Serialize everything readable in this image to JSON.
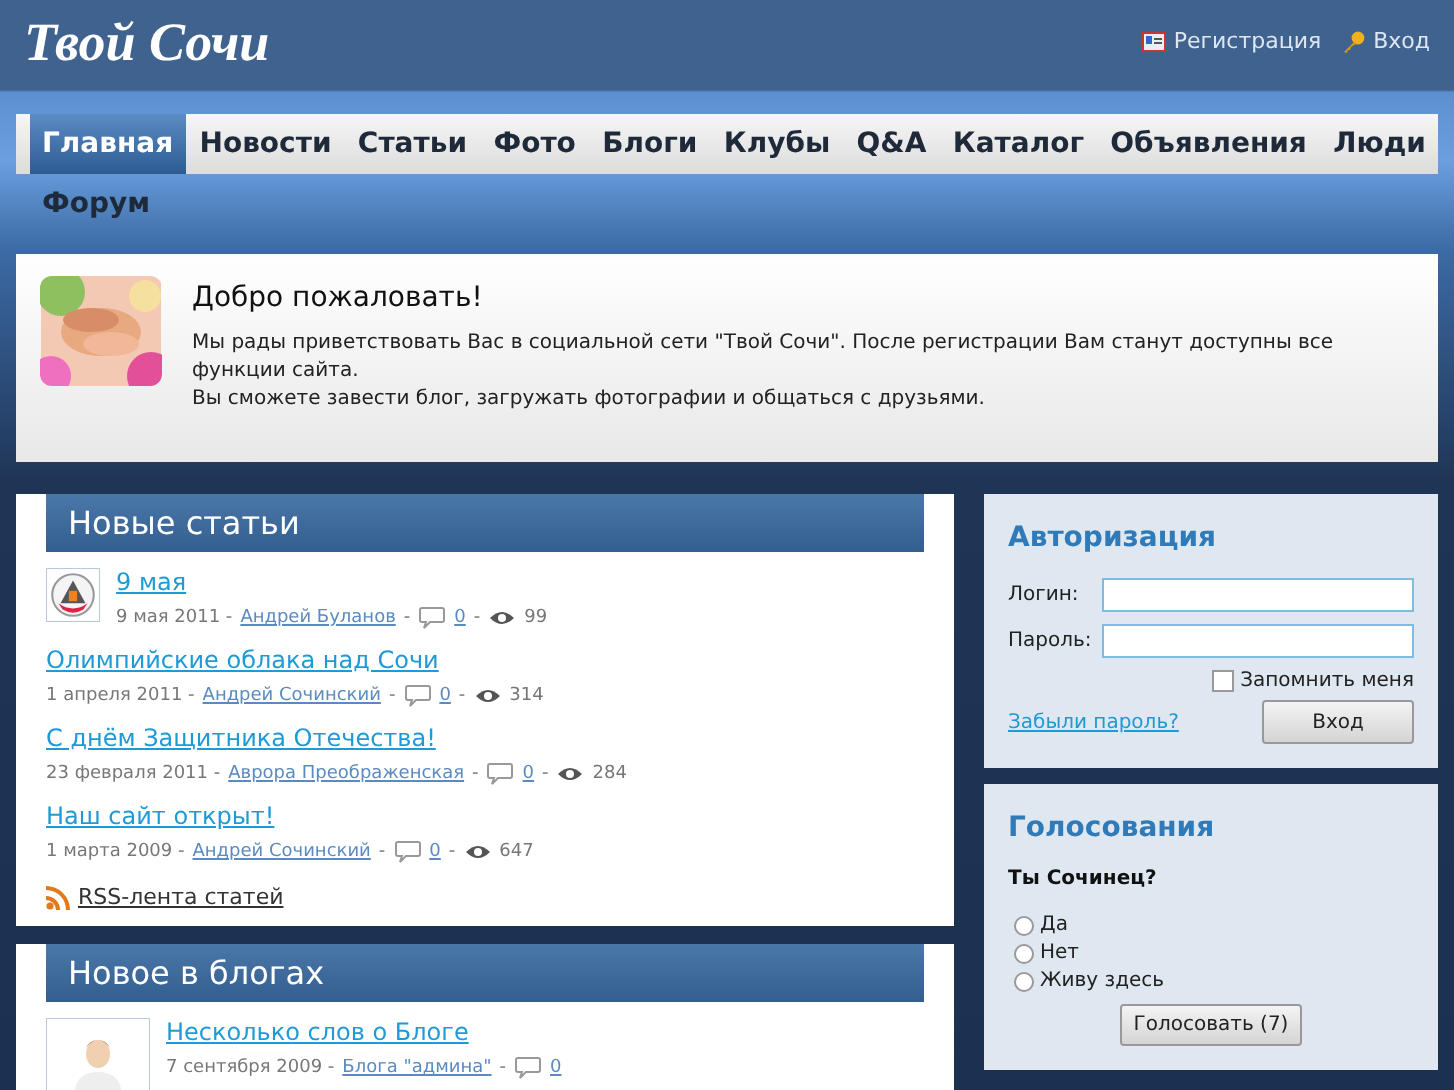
{
  "header": {
    "logo": "Твой Сочи",
    "links": [
      {
        "kind": "register",
        "label": "Регистрация"
      },
      {
        "kind": "login",
        "label": "Вход"
      }
    ]
  },
  "nav": [
    {
      "label": "Главная",
      "selected": true
    },
    {
      "label": "Новости",
      "selected": false
    },
    {
      "label": "Статьи",
      "selected": false
    },
    {
      "label": "Фото",
      "selected": false
    },
    {
      "label": "Блоги",
      "selected": false
    },
    {
      "label": "Клубы",
      "selected": false
    },
    {
      "label": "Q&A",
      "selected": false
    },
    {
      "label": "Каталог",
      "selected": false
    },
    {
      "label": "Объявления",
      "selected": false
    },
    {
      "label": "Люди",
      "selected": false
    },
    {
      "label": "Форум",
      "selected": false
    }
  ],
  "welcome": {
    "title": "Добро пожаловать!",
    "lines": [
      "Мы рады приветствовать Вас в социальной сети \"Твой Сочи\". После регистрации Вам станут доступны все функции сайта.",
      "Вы сможете завести блог, загружать фотографии и общаться с друзьями."
    ]
  },
  "sections": [
    {
      "title": "Новые статьи",
      "items": [
        {
          "title": "9 мая",
          "thumbnail": true,
          "meta": [
            {
              "kind": "text",
              "text": "9 мая 2011 -"
            },
            {
              "kind": "link",
              "text": "Андрей Буланов"
            },
            {
              "kind": "text",
              "text": "-"
            },
            {
              "kind": "comments",
              "text": "0"
            },
            {
              "kind": "text",
              "text": "-"
            },
            {
              "kind": "views",
              "text": "99"
            }
          ]
        },
        {
          "title": "Олимпийские облака над Сочи",
          "meta": [
            {
              "kind": "text",
              "text": "1 апреля 2011 -"
            },
            {
              "kind": "link",
              "text": "Андрей Сочинский"
            },
            {
              "kind": "text",
              "text": "-"
            },
            {
              "kind": "comments",
              "text": "0"
            },
            {
              "kind": "text",
              "text": "-"
            },
            {
              "kind": "views",
              "text": "314"
            }
          ]
        },
        {
          "title": "С днём Защитника Отечества!",
          "meta": [
            {
              "kind": "text",
              "text": "23 февраля 2011 -"
            },
            {
              "kind": "link",
              "text": "Аврора Преображенская"
            },
            {
              "kind": "text",
              "text": "-"
            },
            {
              "kind": "comments",
              "text": "0"
            },
            {
              "kind": "text",
              "text": "-"
            },
            {
              "kind": "views",
              "text": "284"
            }
          ]
        },
        {
          "title": "Наш сайт открыт!",
          "meta": [
            {
              "kind": "text",
              "text": "1 марта 2009 -"
            },
            {
              "kind": "link",
              "text": "Андрей Сочинский"
            },
            {
              "kind": "text",
              "text": "-"
            },
            {
              "kind": "comments",
              "text": "0"
            },
            {
              "kind": "text",
              "text": "-"
            },
            {
              "kind": "views",
              "text": "647"
            }
          ]
        }
      ],
      "rss": "RSS-лента статей"
    },
    {
      "title": "Новое в блогах",
      "items": [
        {
          "title": "Несколько слов о Блоге",
          "thumbnail": true,
          "meta": [
            {
              "kind": "text",
              "text": "7 сентября 2009 -"
            },
            {
              "kind": "link",
              "text": "Блога \"админа\""
            },
            {
              "kind": "text",
              "text": "-"
            },
            {
              "kind": "comments",
              "text": "0"
            }
          ]
        }
      ]
    }
  ],
  "auth": {
    "title": "Авторизация",
    "fields": [
      {
        "label": "Логин:"
      },
      {
        "label": "Пароль:"
      }
    ],
    "remember": {
      "label": "Запомнить меня",
      "checked": false
    },
    "forgot": "Забыли пароль?",
    "submit": "Вход"
  },
  "poll": {
    "title": "Голосования",
    "question": "Ты Сочинец?",
    "options": [
      {
        "label": "Да",
        "selected": false
      },
      {
        "label": "Нет",
        "selected": false
      },
      {
        "label": "Живу здесь",
        "selected": false
      }
    ],
    "submit": "Голосовать (7)"
  }
}
